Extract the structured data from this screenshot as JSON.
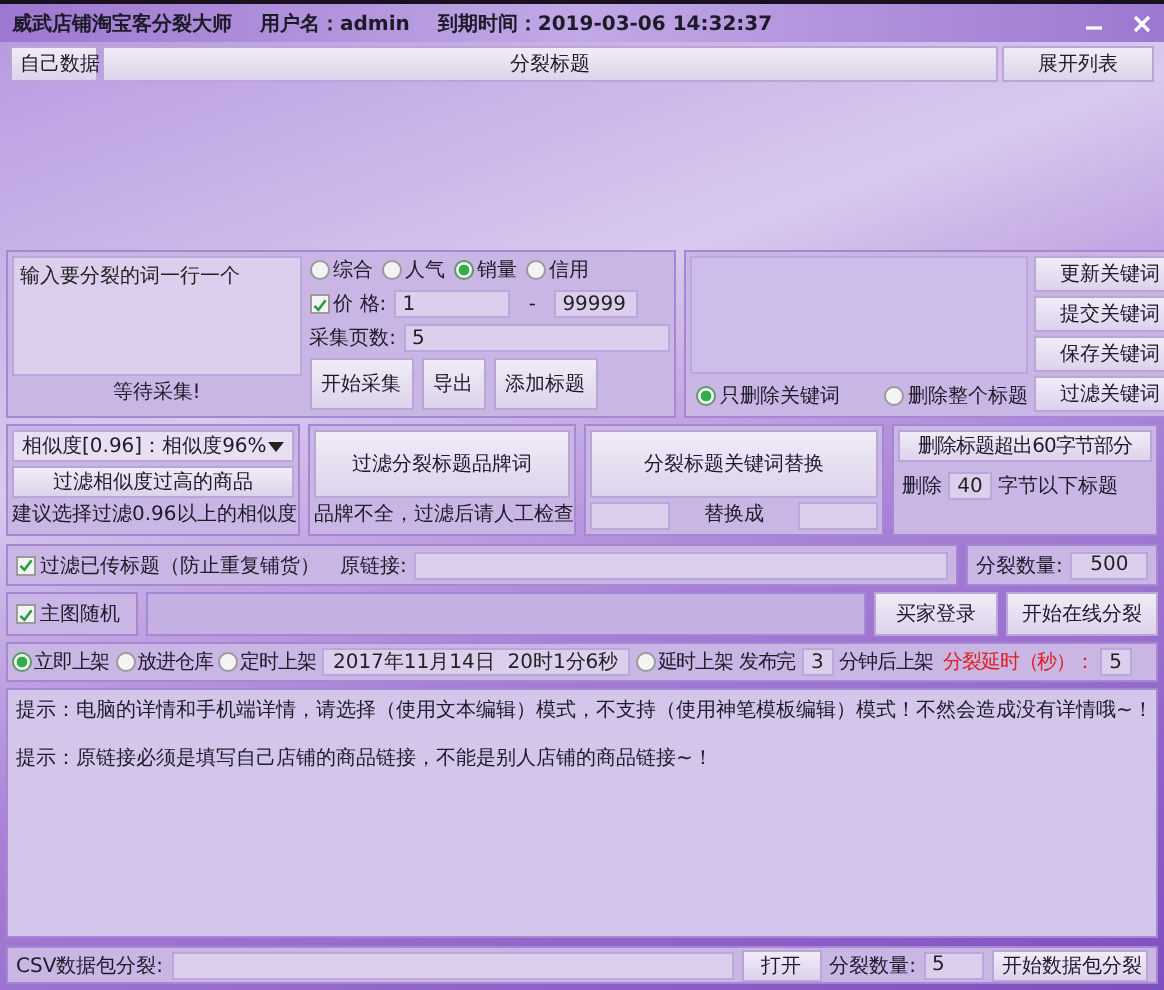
{
  "window": {
    "title": "威武店铺淘宝客分裂大师",
    "user": "用户名：admin",
    "expiry": "到期时间：2019-03-06 14:32:37"
  },
  "toolbar": [
    "自己数据",
    "分裂标题",
    "展开列表"
  ],
  "collect": {
    "placeholder": "输入要分裂的词一行一个",
    "status": "等待采集!",
    "sort": [
      {
        "label": "综合",
        "selected": false
      },
      {
        "label": "人气",
        "selected": false
      },
      {
        "label": "销量",
        "selected": true
      },
      {
        "label": "信用",
        "selected": false
      }
    ],
    "price": {
      "label": "价 格:",
      "checked": true,
      "min": "1",
      "separator": "-",
      "max": "99999"
    },
    "pages": {
      "label": "采集页数:",
      "value": "5"
    },
    "buttons": [
      "开始采集",
      "导出",
      "添加标题"
    ]
  },
  "keywords": {
    "delete_mode": [
      {
        "label": "只删除关键词",
        "selected": true
      },
      {
        "label": "删除整个标题",
        "selected": false
      }
    ],
    "buttons": [
      "更新关键词",
      "提交关键词",
      "保存关键词",
      "过滤关键词"
    ]
  },
  "similarity": {
    "dropdown": "相似度[0.96]：相似度96%",
    "button": "过滤相似度过高的商品",
    "hint": "建议选择过滤0.96以上的相似度"
  },
  "brand": {
    "button": "过滤分裂标题品牌词",
    "hint": "品牌不全，过滤后请人工检查"
  },
  "replace": {
    "button": "分裂标题关键词替换",
    "label": "替换成"
  },
  "trim": {
    "button": "删除标题超出60字节部分",
    "prefix": "删除",
    "bytes": "40",
    "suffix": "字节以下标题"
  },
  "filter_row": {
    "checkbox": {
      "label": "过滤已传标题（防止重复铺货）",
      "checked": true
    },
    "link_label": "原链接:",
    "count_label": "分裂数量:",
    "count": "500"
  },
  "image_row": {
    "checkbox": {
      "label": "主图随机",
      "checked": true
    },
    "buttons": [
      "买家登录",
      "开始在线分裂"
    ]
  },
  "publish": {
    "modes": [
      {
        "label": "立即上架",
        "selected": true
      },
      {
        "label": "放进仓库",
        "selected": false
      },
      {
        "label": "定时上架",
        "selected": false
      }
    ],
    "datetime": "2017年11月14日  20时1分6秒",
    "delay": {
      "label": "延时上架",
      "selected": false
    },
    "after_label": "发布完",
    "minutes": "3",
    "minutes_suffix": "分钟后上架",
    "split_delay_label": "分裂延时（秒）：",
    "split_delay": "5"
  },
  "log": [
    "提示：电脑的详情和手机端详情，请选择（使用文本编辑）模式，不支持（使用神笔模板编辑）模式！不然会造成没有详情哦~！",
    "提示：原链接必须是填写自己店铺的商品链接，不能是别人店铺的商品链接~！"
  ],
  "csv": {
    "label": "CSV数据包分裂:",
    "open_button": "打开",
    "count_label": "分裂数量:",
    "count": "5",
    "start_button": "开始数据包分裂"
  }
}
